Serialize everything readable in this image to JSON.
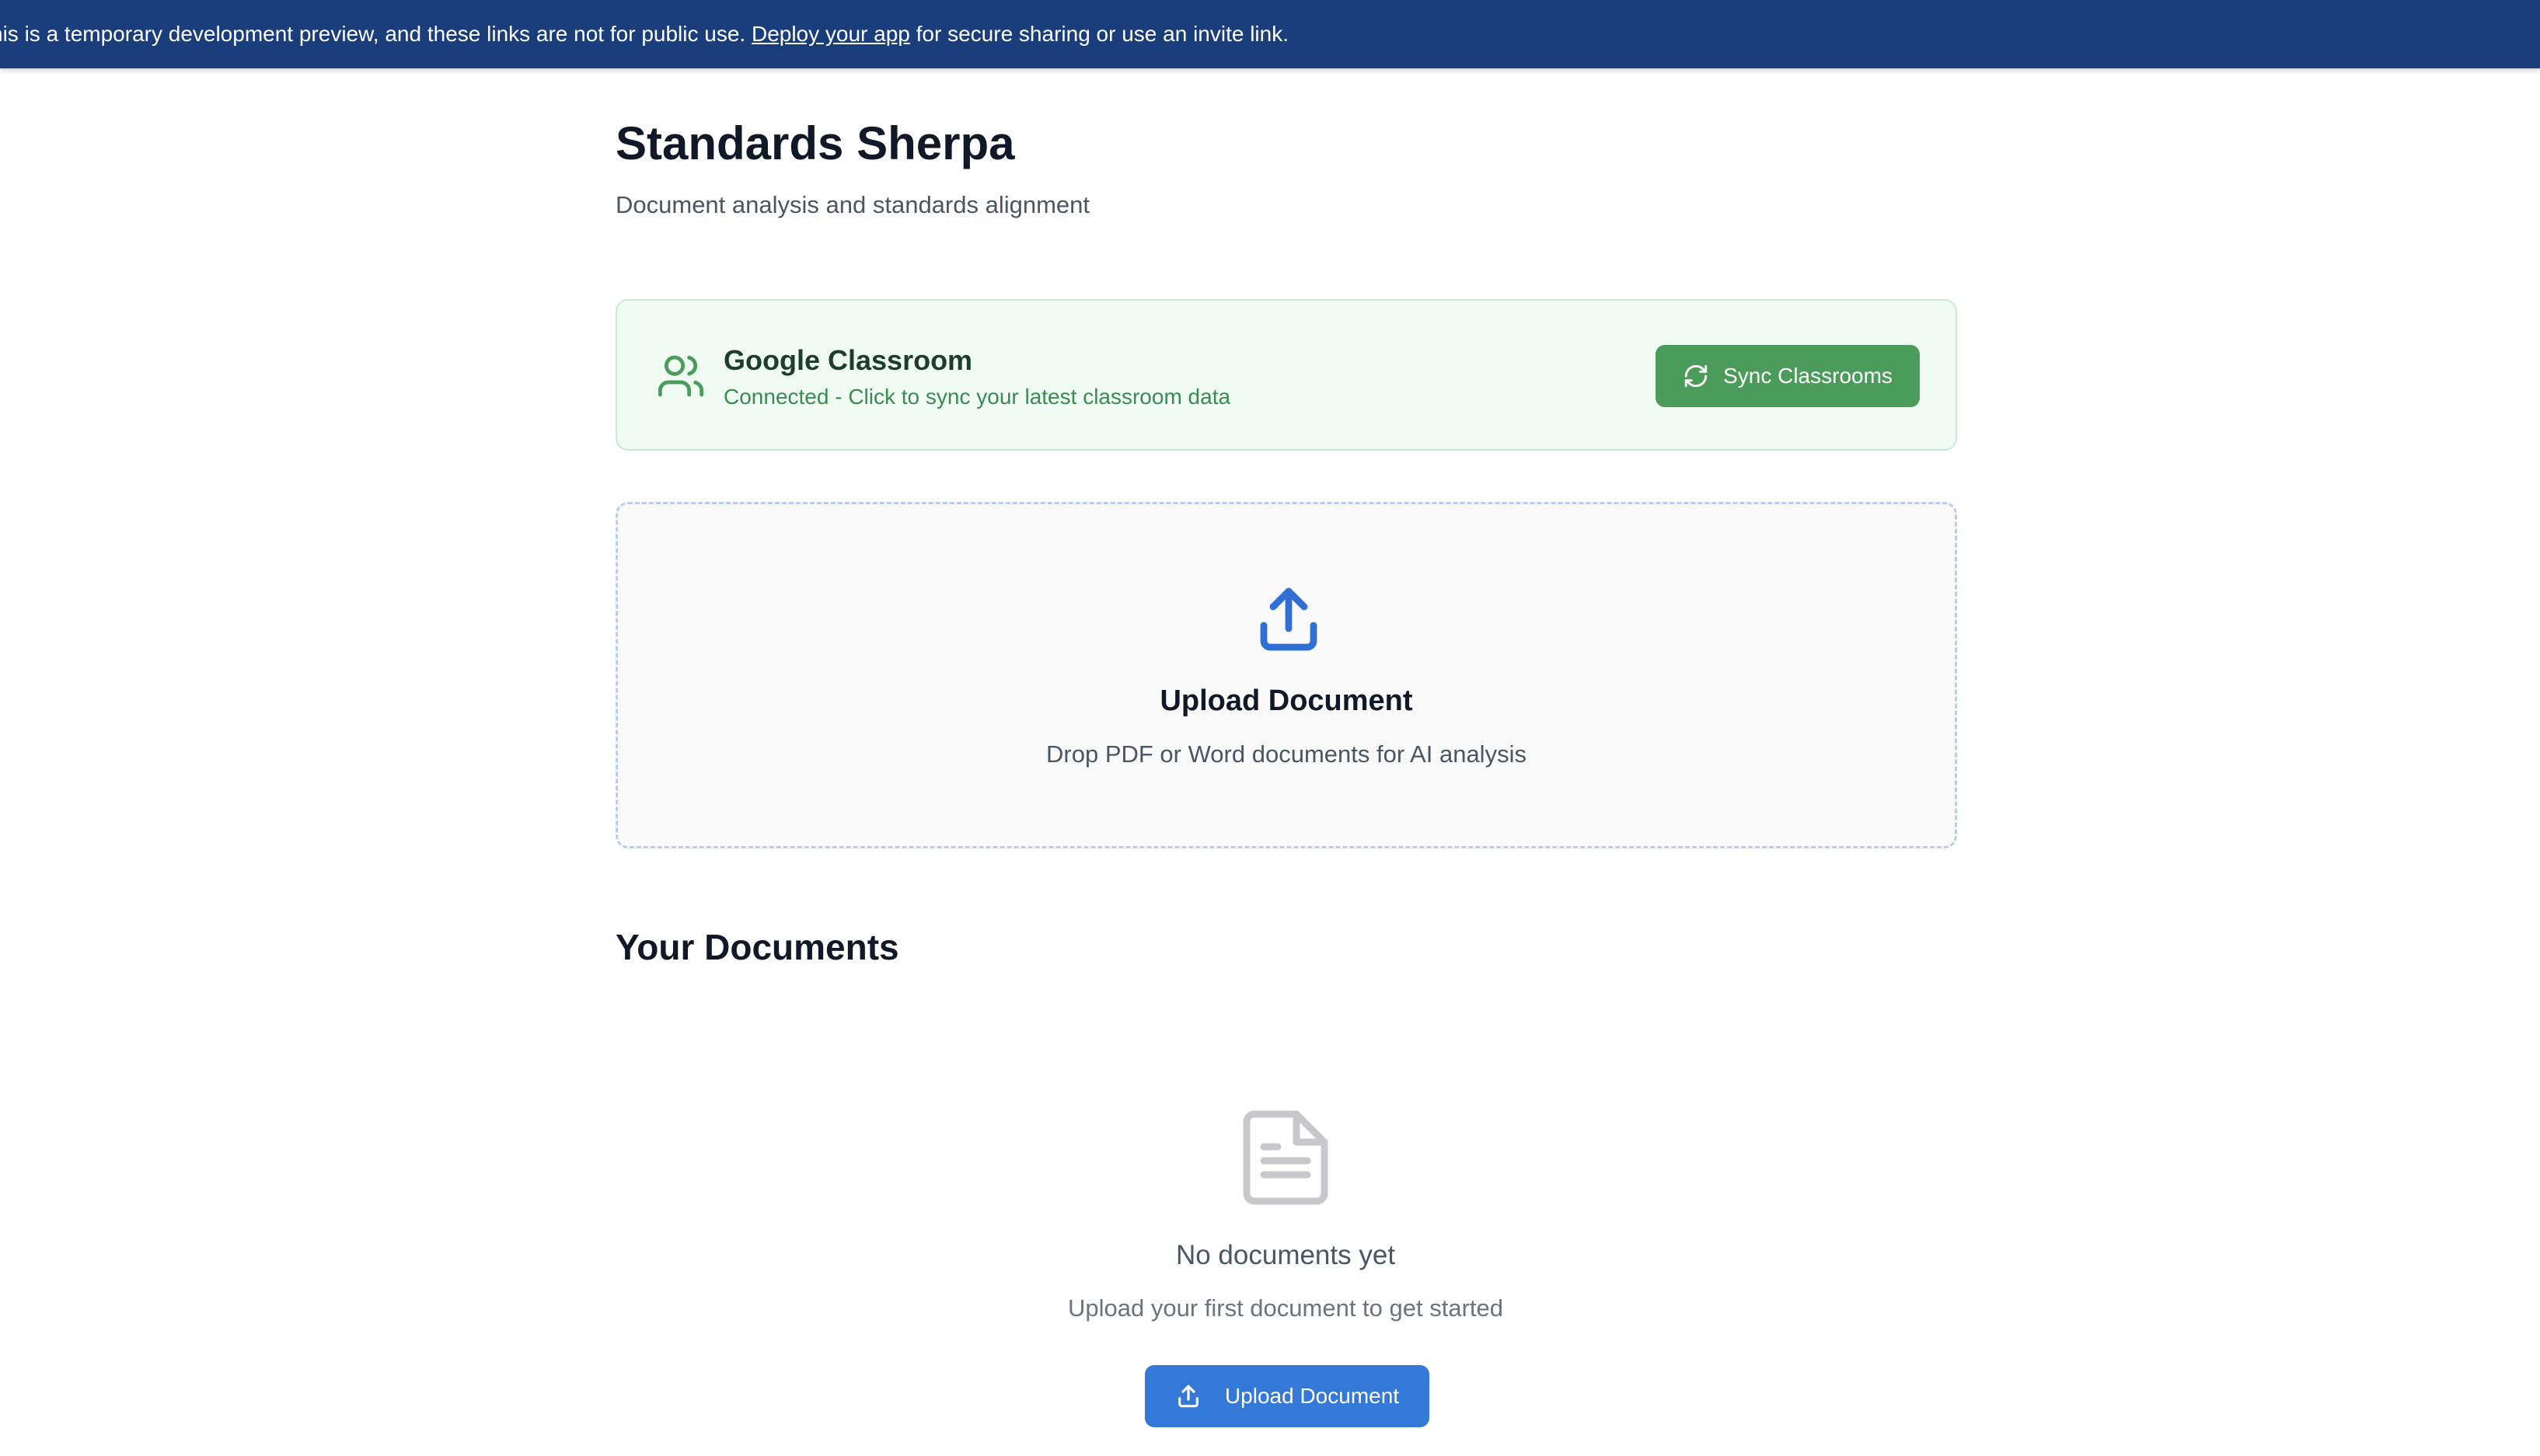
{
  "banner": {
    "text_before": "his is a temporary development preview, and these links are not for public use.",
    "link_text": "Deploy your app",
    "text_after": "for secure sharing or use an invite link.",
    "background": "#1a3d7c"
  },
  "header": {
    "title": "Standards Sherpa",
    "subtitle": "Document analysis and standards alignment"
  },
  "google_classroom": {
    "icon": "users-icon",
    "title": "Google Classroom",
    "status": "Connected - Click to sync your latest classroom data",
    "button_icon": "refresh-icon",
    "button_label": "Sync Classrooms",
    "accent": "#4b9b5a"
  },
  "upload_zone": {
    "icon": "upload-icon",
    "title": "Upload Document",
    "description": "Drop PDF or Word documents for AI analysis",
    "accent": "#2f6fd6"
  },
  "documents": {
    "heading": "Your Documents",
    "empty_icon": "document-icon",
    "empty_title": "No documents yet",
    "empty_description": "Upload your first document to get started",
    "button_icon": "upload-icon",
    "button_label": "Upload Document",
    "accent": "#3478d8"
  }
}
